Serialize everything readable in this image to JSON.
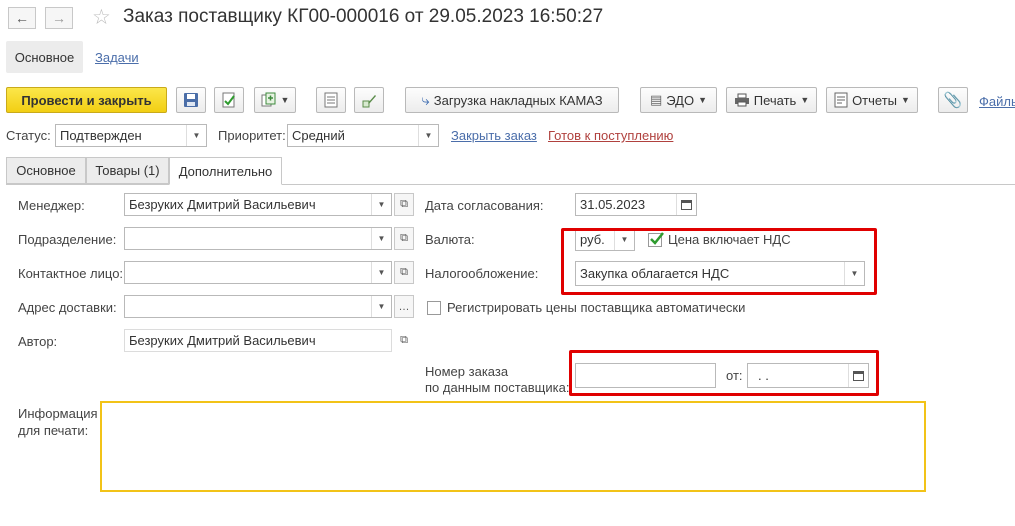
{
  "header": {
    "back_icon": "arrow-left-icon",
    "forward_icon": "arrow-right-icon",
    "favorite_icon": "star-icon",
    "title": "Заказ поставщику КГ00-000016 от 29.05.2023 16:50:27"
  },
  "modes": {
    "main_label": "Основное",
    "tasks_label": "Задачи"
  },
  "toolbar": {
    "post_close_label": "Провести и закрыть",
    "kamaz_label": "Загрузка накладных КАМАЗ",
    "edo_label": "ЭДО",
    "print_label": "Печать",
    "reports_label": "Отчеты",
    "files_label": "Файлы"
  },
  "status_row": {
    "status_label": "Статус:",
    "status_value": "Подтвержден",
    "priority_label": "Приоритет:",
    "priority_value": "Средний",
    "close_order_link": "Закрыть заказ",
    "ready_link": "Готов к поступлению"
  },
  "tabs": [
    {
      "label": "Основное"
    },
    {
      "label": "Товары (1)"
    },
    {
      "label": "Дополнительно"
    }
  ],
  "form": {
    "manager_label": "Менеджер:",
    "manager_value": "Безруких Дмитрий Васильевич",
    "department_label": "Подразделение:",
    "department_value": "",
    "contact_label": "Контактное лицо:",
    "contact_value": "",
    "address_label": "Адрес доставки:",
    "address_value": "",
    "author_label": "Автор:",
    "author_value": "Безруких Дмитрий Васильевич",
    "approval_date_label": "Дата согласования:",
    "approval_date_value": "31.05.2023",
    "currency_label": "Валюта:",
    "currency_value": "руб.",
    "price_incl_vat_label": "Цена включает НДС",
    "price_incl_vat_checked": true,
    "taxation_label": "Налогообложение:",
    "taxation_value": "Закупка облагается НДС",
    "register_prices_label": "Регистрировать цены поставщика автоматически",
    "register_prices_checked": false,
    "supplier_order_label_line1": "Номер заказа",
    "supplier_order_label_line2": "по данным поставщика:",
    "supplier_order_value": "",
    "from_label": "от:",
    "from_value": " .  .",
    "print_info_label_line1": "Информация",
    "print_info_label_line2": "для печати:",
    "print_info_value": ""
  },
  "colors": {
    "primary_button": "#f2cf13",
    "highlight_red": "#e00000",
    "highlight_yellow": "#f2c318",
    "link_blue": "#4b6eaa",
    "link_red": "#b0413e"
  }
}
